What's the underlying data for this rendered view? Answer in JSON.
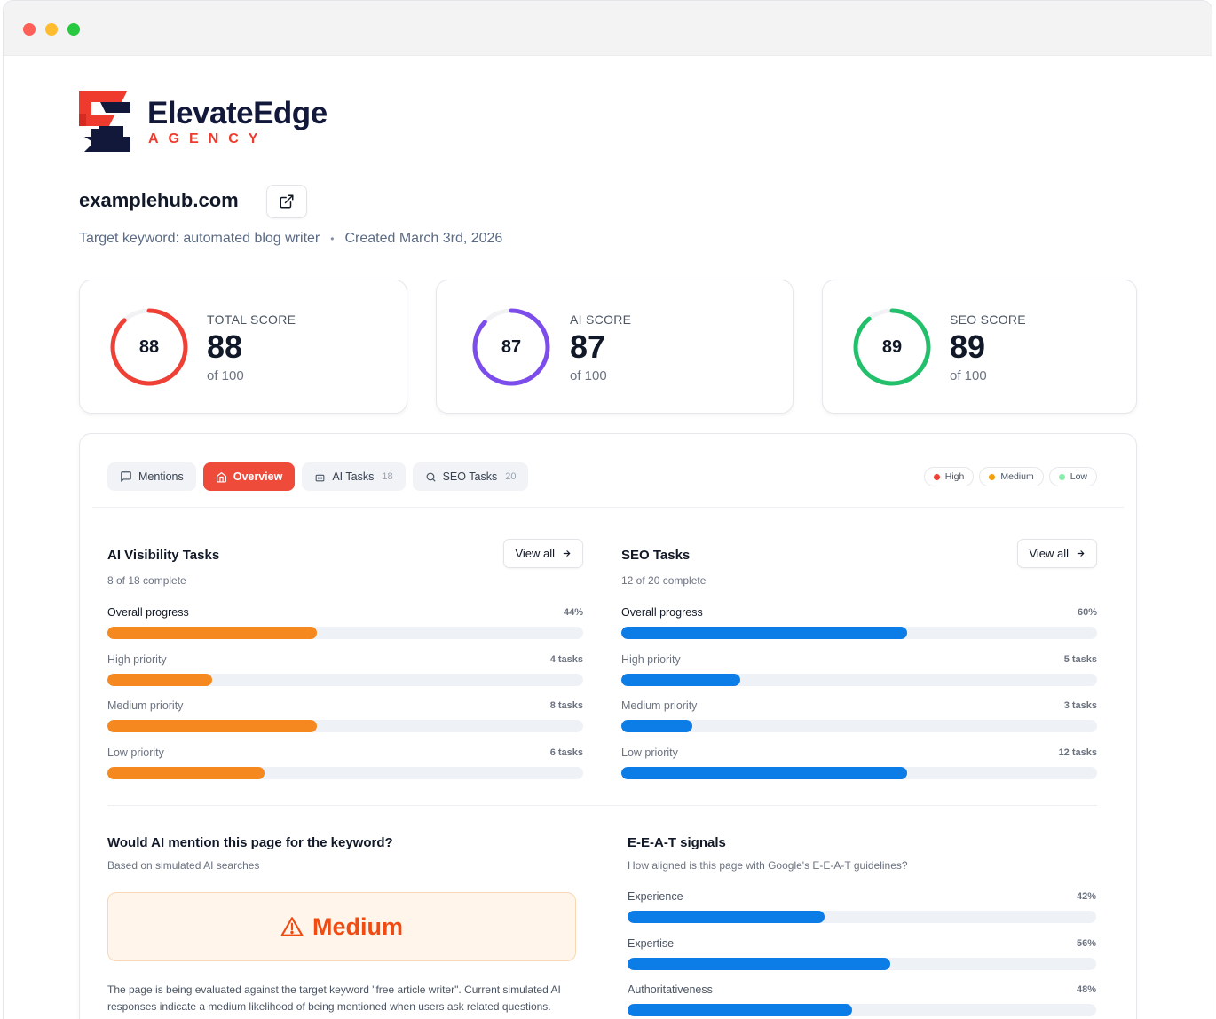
{
  "brand": {
    "name": "ElevateEdge",
    "tagline": "AGENCY"
  },
  "site": {
    "domain": "examplehub.com",
    "target_keyword": "Target keyword: automated blog writer",
    "created": "Created March 3rd, 2026"
  },
  "scores": [
    {
      "label": "TOTAL SCORE",
      "value": "88",
      "of": "of 100",
      "percent": 88,
      "color": "#ef4036"
    },
    {
      "label": "AI SCORE",
      "value": "87",
      "of": "of 100",
      "percent": 87,
      "color": "#7c4deb"
    },
    {
      "label": "SEO SCORE",
      "value": "89",
      "of": "of 100",
      "percent": 89,
      "color": "#22c06a"
    }
  ],
  "tabs": [
    {
      "label": "Mentions",
      "count": ""
    },
    {
      "label": "Overview",
      "count": ""
    },
    {
      "label": "AI Tasks",
      "count": "18"
    },
    {
      "label": "SEO Tasks",
      "count": "20"
    }
  ],
  "legend": [
    {
      "label": "High",
      "color": "#ef4036"
    },
    {
      "label": "Medium",
      "color": "#f59e0b"
    },
    {
      "label": "Low",
      "color": "#86efac"
    }
  ],
  "ai_tasks": {
    "title": "AI Visibility Tasks",
    "view_all": "View all",
    "subtitle": "8 of 18 complete",
    "color": "#f5891f",
    "rows": [
      {
        "label": "Overall progress",
        "value": "44%",
        "fill": 0.44
      },
      {
        "label": "High priority",
        "value": "4 tasks",
        "fill": 0.22
      },
      {
        "label": "Medium priority",
        "value": "8 tasks",
        "fill": 0.44
      },
      {
        "label": "Low priority",
        "value": "6 tasks",
        "fill": 0.33
      }
    ]
  },
  "seo_tasks": {
    "title": "SEO Tasks",
    "view_all": "View all",
    "subtitle": "12 of 20 complete",
    "color": "#0c7ce6",
    "rows": [
      {
        "label": "Overall progress",
        "value": "60%",
        "fill": 0.6
      },
      {
        "label": "High priority",
        "value": "5 tasks",
        "fill": 0.25
      },
      {
        "label": "Medium priority",
        "value": "3 tasks",
        "fill": 0.15
      },
      {
        "label": "Low priority",
        "value": "12 tasks",
        "fill": 0.6
      }
    ]
  },
  "mention": {
    "title": "Would AI mention this page for the keyword?",
    "subtitle": "Based on simulated AI searches",
    "verdict": "Medium",
    "description": "The page is being evaluated against the target keyword \"free article writer\". Current simulated AI responses indicate a medium likelihood of being mentioned when users ask related questions."
  },
  "eeat": {
    "title": "E-E-A-T signals",
    "subtitle": "How aligned is this page with Google's E-E-A-T guidelines?",
    "color": "#0c7ce6",
    "rows": [
      {
        "label": "Experience",
        "value": "42%",
        "fill": 0.42
      },
      {
        "label": "Expertise",
        "value": "56%",
        "fill": 0.56
      },
      {
        "label": "Authoritativeness",
        "value": "48%",
        "fill": 0.48
      }
    ]
  }
}
